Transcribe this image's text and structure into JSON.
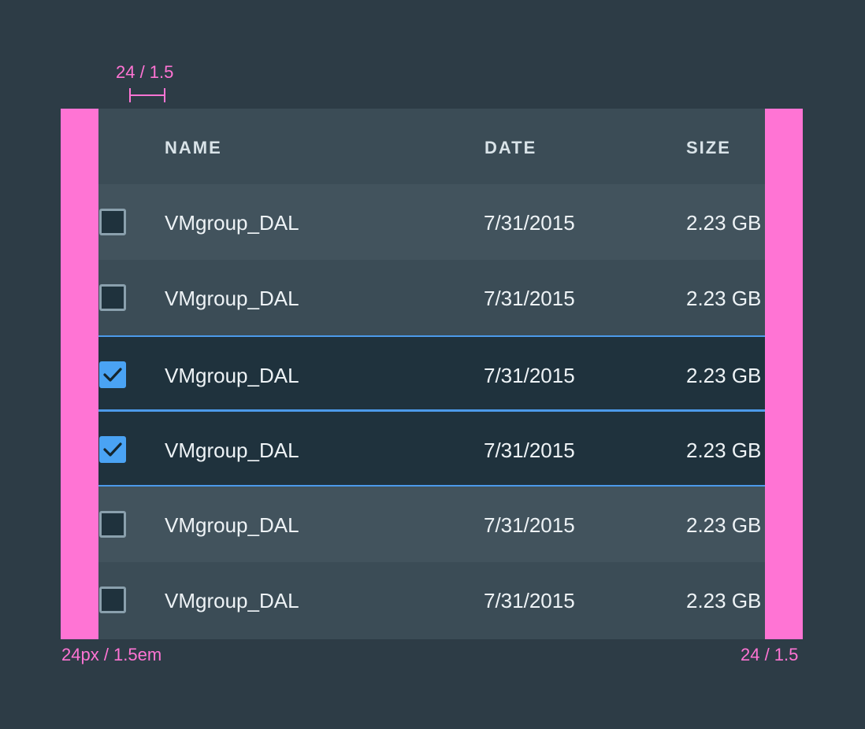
{
  "annotations": {
    "top_measure": "24 / 1.5",
    "left_padding": "24px / 1.5em",
    "right_padding": "24 / 1.5"
  },
  "colors": {
    "background": "#2d3c46",
    "annotation": "#ff74d4",
    "selection_border": "#4c9aea",
    "checkbox_checked": "#4aa3f4"
  },
  "table": {
    "columns": [
      "NAME",
      "DATE",
      "SIZE"
    ],
    "rows": [
      {
        "checked": false,
        "name": "VMgroup_DAL",
        "date": "7/31/2015",
        "size": "2.23 GB"
      },
      {
        "checked": false,
        "name": "VMgroup_DAL",
        "date": "7/31/2015",
        "size": "2.23 GB"
      },
      {
        "checked": true,
        "name": "VMgroup_DAL",
        "date": "7/31/2015",
        "size": "2.23 GB"
      },
      {
        "checked": true,
        "name": "VMgroup_DAL",
        "date": "7/31/2015",
        "size": "2.23 GB"
      },
      {
        "checked": false,
        "name": "VMgroup_DAL",
        "date": "7/31/2015",
        "size": "2.23 GB"
      },
      {
        "checked": false,
        "name": "VMgroup_DAL",
        "date": "7/31/2015",
        "size": "2.23 GB"
      }
    ]
  }
}
